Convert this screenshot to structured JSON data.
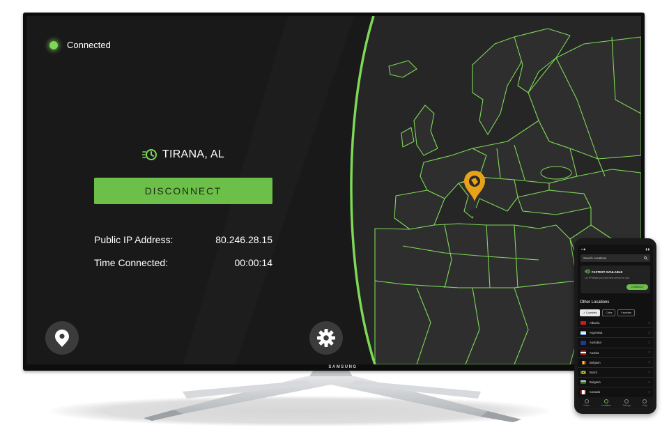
{
  "tv": {
    "brand": "SAMSUNG",
    "status_label": "Connected",
    "location": "TIRANA, AL",
    "disconnect_label": "DISCONNECT",
    "info": [
      {
        "label": "Public IP Address:",
        "value": "80.246.28.15"
      },
      {
        "label": "Time Connected:",
        "value": "00:00:14"
      }
    ],
    "icons": {
      "status": "status-dot",
      "location": "timer-icon",
      "locations_button": "map-pin-icon",
      "settings_button": "gear-icon",
      "marker": "location-marker-icon"
    }
  },
  "phone": {
    "search_placeholder": "Search Locations",
    "fastest_title": "FASTEST AVAILABLE",
    "fastest_sub": "Let IPVanish pick the best server for you",
    "connect_label": "CONNECT",
    "other_locations": "Other Locations",
    "chips": [
      "Countries",
      "Cities",
      "Favorites"
    ],
    "countries": [
      "Albania",
      "Argentina",
      "Australia",
      "Austria",
      "Belgium",
      "Brazil",
      "Bulgaria",
      "Canada"
    ],
    "nav": [
      "Home",
      "Locations",
      "Settings",
      "Help"
    ]
  },
  "colors": {
    "accent": "#6cc04a",
    "screen_bg": "#191919",
    "map_land": "#2c2c2c",
    "map_border": "#7ed957",
    "marker": "#e8a21a"
  }
}
